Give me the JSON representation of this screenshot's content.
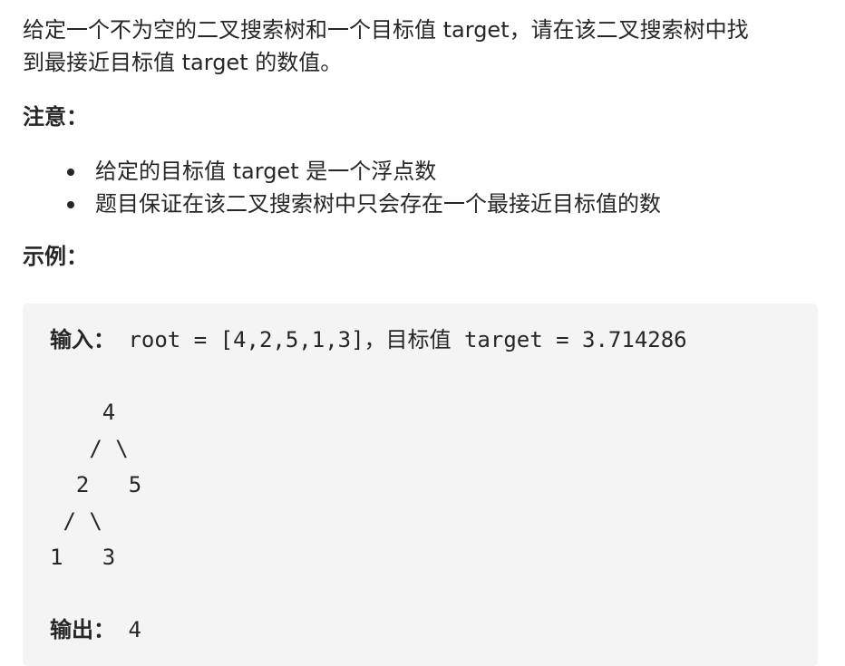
{
  "description": {
    "line1": "给定一个不为空的二叉搜索树和一个目标值 target，请在该二叉搜索树中找",
    "line2": "到最接近目标值 target 的数值。"
  },
  "note": {
    "title": "注意：",
    "items": [
      "给定的目标值 target 是一个浮点数",
      "题目保证在该二叉搜索树中只会存在一个最接近目标值的数"
    ]
  },
  "example": {
    "title": "示例：",
    "input_label": "输入：",
    "input_value": " root = [4,2,5,1,3]，目标值 target = 3.714286",
    "tree_lines": [
      "    4",
      "   / \\",
      "  2   5",
      " / \\",
      "1   3"
    ],
    "output_label": "输出：",
    "output_value": " 4"
  }
}
